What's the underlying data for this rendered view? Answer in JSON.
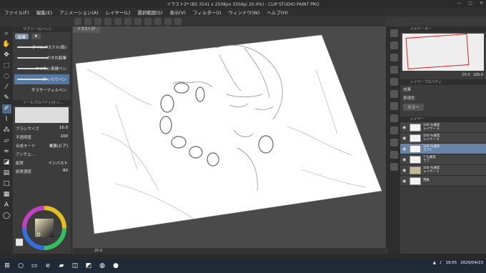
{
  "window": {
    "title": "イラスト2* (B5 3541 x 2508px 350dpi 20.0%)  - CLIP STUDIO PAINT PRO",
    "controls": [
      "—",
      "□",
      "✕"
    ]
  },
  "menu": [
    "ファイル(F)",
    "編集(E)",
    "アニメーション(A)",
    "レイヤー(L)",
    "選択範囲(S)",
    "表示(V)",
    "フィルター(I)",
    "ウィンドウ(W)",
    "ヘルプ(H)"
  ],
  "subtool": {
    "header": "サブツール[ペン]",
    "tabs": [
      "鉛筆",
      "★"
    ],
    "brushes": [
      "タイルパステル(鉛)",
      "かすれ鉛筆",
      "ヤマサン来線ペン",
      "かっちりペン",
      "サラサーフェルペン"
    ],
    "active_index": 3
  },
  "toolprop": {
    "header": "ツールプロパティ[かっ…",
    "rows": [
      {
        "label": "ブラシサイズ",
        "value": "10.0"
      },
      {
        "label": "不透明度",
        "value": "100"
      },
      {
        "label": "合成モード",
        "value": "乗算(ビア)"
      },
      {
        "label": "アンチエ…",
        "value": ""
      },
      {
        "label": "紙質",
        "value": "インバスト"
      },
      {
        "label": "紙質濃度",
        "value": "80"
      }
    ]
  },
  "canvas": {
    "doc_tab": "イラスト2*",
    "bottom_readout": "20.0"
  },
  "navigator": {
    "header": "ナビゲーター",
    "zoom": "20.0",
    "angle": "189.0"
  },
  "layer_property": {
    "header": "レイヤープロパティ",
    "effect_label": "効果",
    "color_label": "表現色",
    "color_value": "カラー"
  },
  "layers": {
    "header": "レイヤー",
    "items": [
      {
        "blend": "100 %通常",
        "name": "レイヤー 3"
      },
      {
        "blend": "100 %通常",
        "name": "レイヤー 4"
      },
      {
        "blend": "100 %通常",
        "name": "ラフ1"
      },
      {
        "blend": "7 %通常",
        "name": "ラフ"
      },
      {
        "blend": "100 %通常",
        "name": "レイヤー 1"
      },
      {
        "blend": "",
        "name": "用紙"
      }
    ],
    "active_index": 2
  },
  "taskbar": {
    "time": "19:55",
    "date": "2020/04/23"
  },
  "colors": {
    "accent": "#5577a0",
    "nav_frame": "#e02020"
  }
}
